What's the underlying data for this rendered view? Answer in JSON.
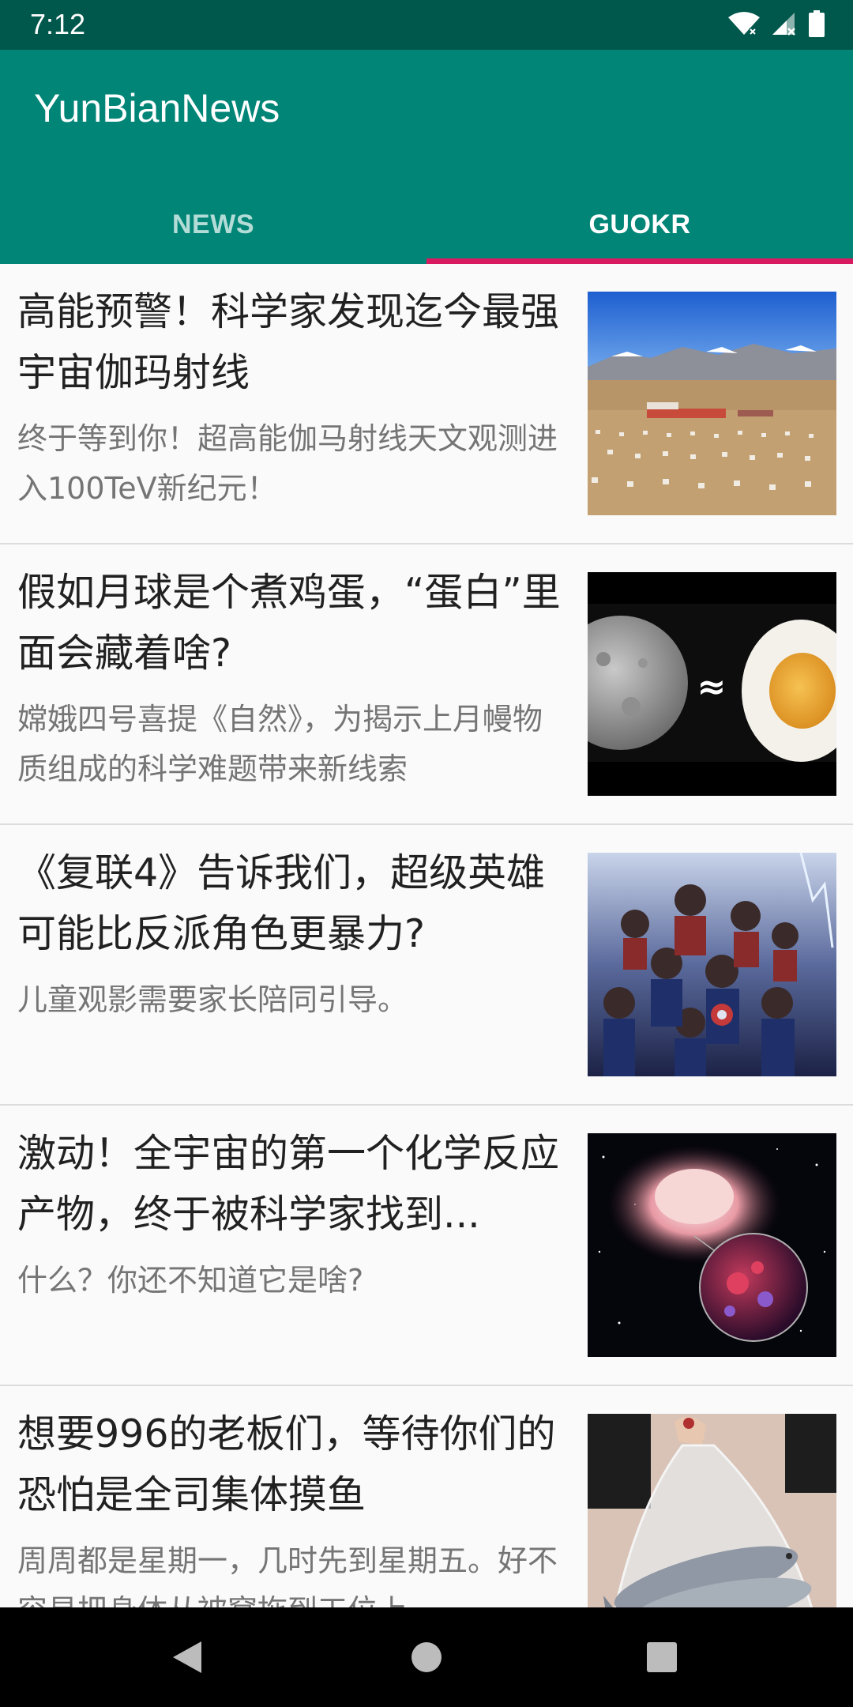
{
  "status_bar": {
    "time": "7:12",
    "icons": [
      "wifi-icon",
      "signal-icon",
      "battery-icon"
    ]
  },
  "app_bar": {
    "title": "YunBianNews",
    "background": "#008577"
  },
  "tabs": [
    {
      "label": "NEWS",
      "selected": false
    },
    {
      "label": "GUOKR",
      "selected": true
    }
  ],
  "accent_color": "#d81b60",
  "articles": [
    {
      "title": "高能预警！科学家发现迄今最强宇宙伽玛射线",
      "summary": "终于等到你！超高能伽马射线天文观测进入100TeV新纪元！",
      "thumbnail": "observatory-image"
    },
    {
      "title": "假如月球是个煮鸡蛋，“蛋白”里面会藏着啥?",
      "summary": "嫦娥四号喜提《自然》，为揭示上月幔物质组成的科学难题带来新线索",
      "thumbnail": "moon-egg-image"
    },
    {
      "title": "《复联4》告诉我们，超级英雄可能比反派角色更暴力?",
      "summary": "儿童观影需要家长陪同引导。",
      "thumbnail": "avengers-poster-image"
    },
    {
      "title": "激动！全宇宙的第一个化学反应产物，终于被科学家找到...",
      "summary": "什么？你还不知道它是啥?",
      "thumbnail": "nebula-image"
    },
    {
      "title": "想要996的老板们，等待你们的恐怕是全司集体摸鱼",
      "summary": "周周都是星期一，几时先到星期五。好不容易把身体从被窝拖到工位上，...",
      "thumbnail": "fish-bag-image"
    }
  ],
  "nav_bar": {
    "buttons": [
      "back-icon",
      "home-icon",
      "recents-icon"
    ]
  }
}
